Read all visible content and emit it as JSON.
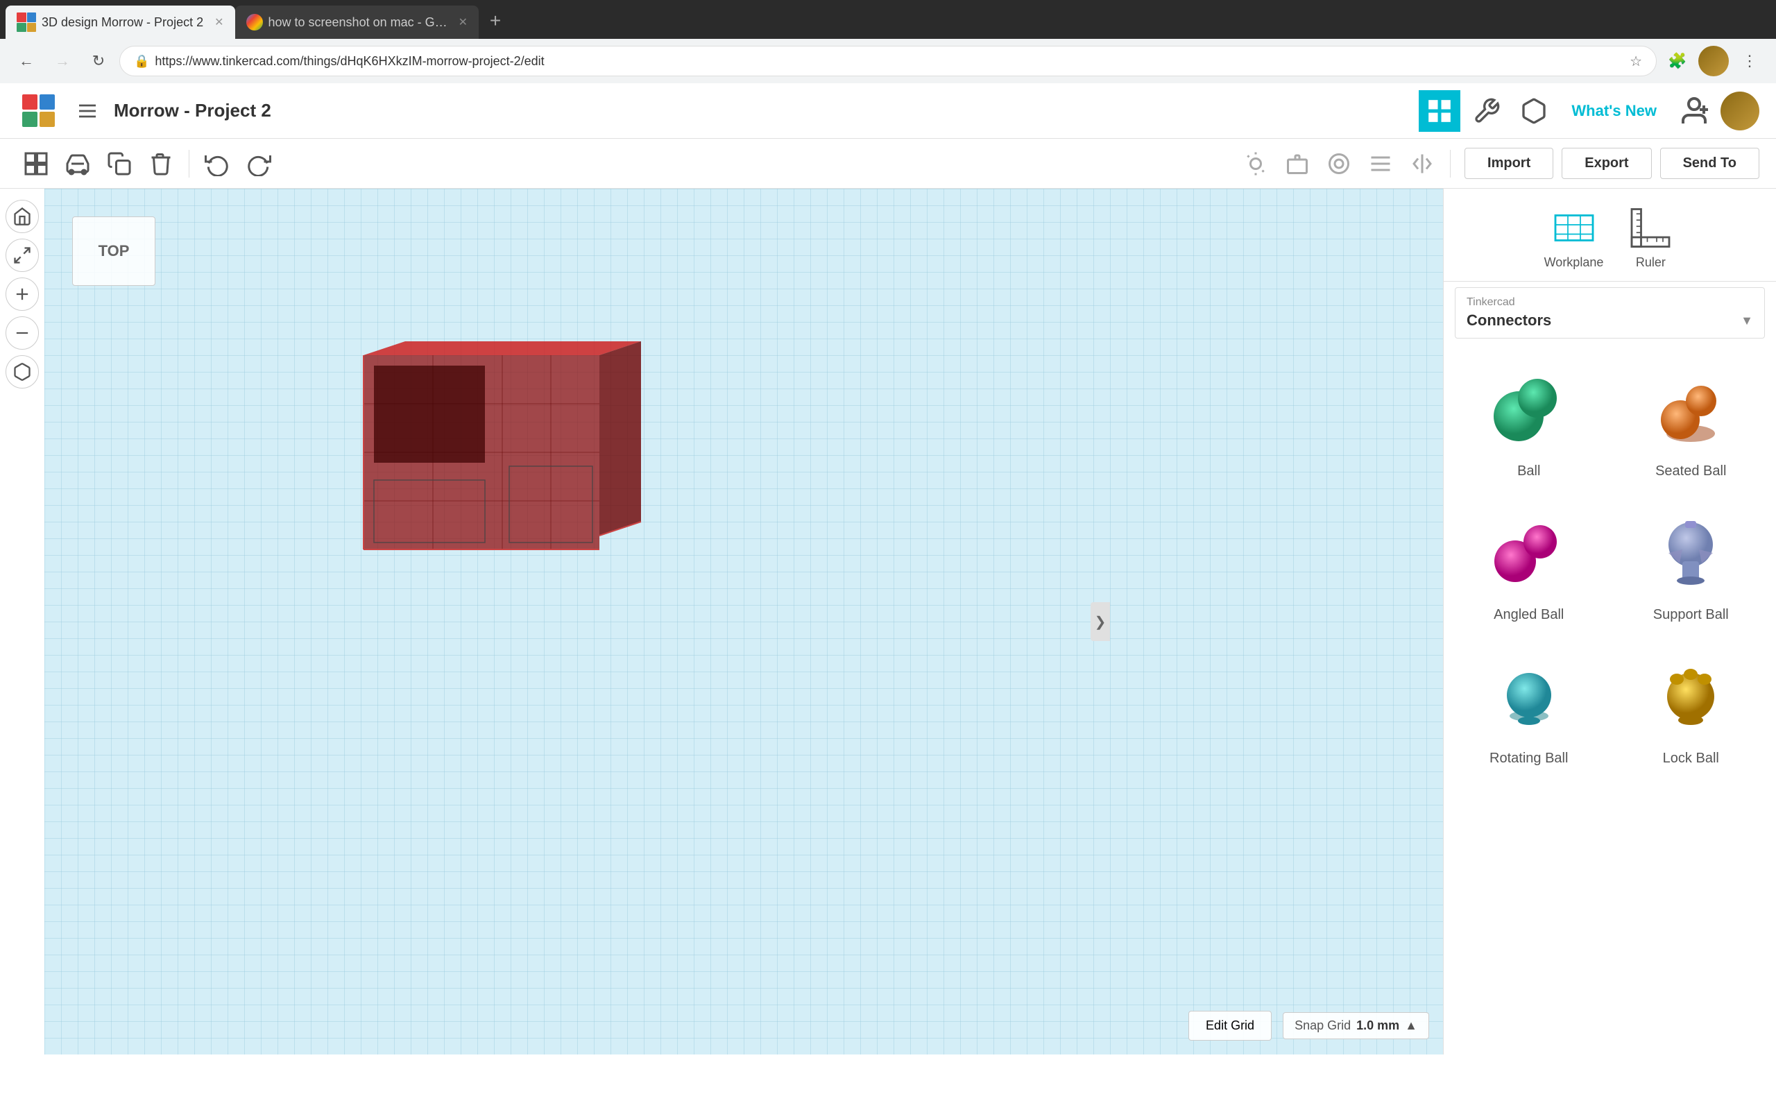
{
  "browser": {
    "tabs": [
      {
        "id": "tinkercad",
        "label": "3D design Morrow - Project 2",
        "favicon": "tinkercad",
        "active": true
      },
      {
        "id": "google",
        "label": "how to screenshot on mac - G…",
        "favicon": "google",
        "active": false
      }
    ],
    "address": "https://www.tinkercad.com/things/dHqK6HXkzIM-morrow-project-2/edit",
    "new_tab_label": "+"
  },
  "app": {
    "logo_alt": "Tinkercad",
    "project_title": "Morrow - Project 2",
    "whats_new": "What's New",
    "toolbar": {
      "import": "Import",
      "export": "Export",
      "send_to": "Send To"
    },
    "sidebar_label": "Tinkercad",
    "category": "Connectors",
    "shapes": [
      {
        "name": "Ball",
        "color": "#2db891"
      },
      {
        "name": "Seated Ball",
        "color": "#e07830"
      },
      {
        "name": "Angled Ball",
        "color": "#cc2288"
      },
      {
        "name": "Support Ball",
        "color": "#9090c0"
      },
      {
        "name": "Rotating Ball",
        "color": "#40b8c0"
      },
      {
        "name": "Lock Ball",
        "color": "#d4b020"
      }
    ],
    "bottom_controls": {
      "edit_grid": "Edit Grid",
      "snap_grid_label": "Snap Grid",
      "snap_grid_value": "1.0 mm"
    },
    "view_cube_label": "TOP",
    "panel_tools": {
      "workplane": "Workplane",
      "ruler": "Ruler"
    }
  }
}
